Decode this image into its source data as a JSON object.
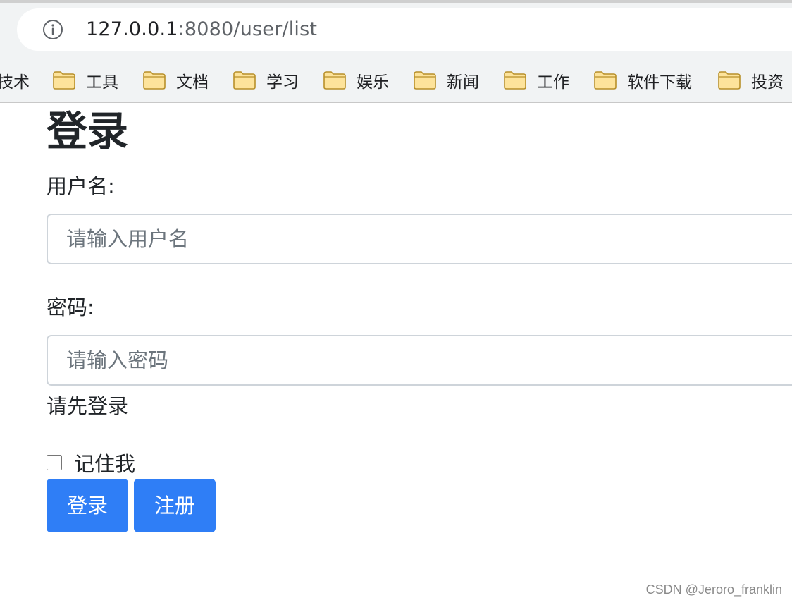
{
  "browser": {
    "url_host": "127.0.0.1",
    "url_path": ":8080/user/list",
    "bookmarks": [
      {
        "label": "技术",
        "icon": "folder-icon"
      },
      {
        "label": "工具",
        "icon": "folder-icon"
      },
      {
        "label": "文档",
        "icon": "folder-icon"
      },
      {
        "label": "学习",
        "icon": "folder-icon"
      },
      {
        "label": "娱乐",
        "icon": "folder-icon"
      },
      {
        "label": "新闻",
        "icon": "folder-icon"
      },
      {
        "label": "工作",
        "icon": "folder-icon"
      },
      {
        "label": "软件下载",
        "icon": "folder-icon"
      },
      {
        "label": "投资",
        "icon": "folder-icon"
      }
    ]
  },
  "form": {
    "title": "登录",
    "username_label": "用户名:",
    "username_placeholder": "请输入用户名",
    "username_value": "",
    "password_label": "密码:",
    "password_placeholder": "请输入密码",
    "password_value": "",
    "message": "请先登录",
    "remember_label": "记住我",
    "remember_checked": false,
    "login_button": "登录",
    "register_button": "注册"
  },
  "watermark": "CSDN @Jeroro_franklin",
  "colors": {
    "primary_button": "#2f7ef6",
    "folder_fill": "#fde39b",
    "folder_stroke": "#b8902a"
  }
}
